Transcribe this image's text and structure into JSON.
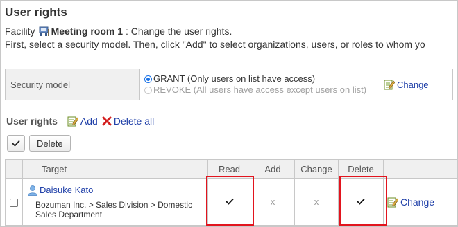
{
  "page": {
    "title": "User rights",
    "facility_prefix": "Facility",
    "facility_name": "Meeting room 1",
    "facility_suffix": ": Change the user rights.",
    "instruction": "First, select a security model. Then, click \"Add\" to select organizations, users, or roles to whom yo"
  },
  "security_model": {
    "label": "Security model",
    "grant_option": "GRANT (Only users on list have access)",
    "revoke_option": "REVOKE (All users have access except users on list)",
    "selected": "GRANT",
    "change_link": "Change"
  },
  "user_rights": {
    "title": "User rights",
    "add_link": "Add",
    "delete_all_link": "Delete all",
    "delete_button": "Delete",
    "columns": {
      "target": "Target",
      "read": "Read",
      "add": "Add",
      "change": "Change",
      "delete": "Delete"
    },
    "rows": [
      {
        "user_name": "Daisuke Kato",
        "organization": "Bozuman Inc. > Sales Division > Domestic Sales Department",
        "read": "granted",
        "add": "x",
        "change": "x",
        "delete": "granted",
        "change_link": "Change"
      }
    ]
  },
  "colors": {
    "link": "#1f3fa8",
    "highlight": "#e2141e",
    "header_bg": "#f0f0f0",
    "radio_selected": "#1a73e8"
  },
  "icons": [
    "facility-icon",
    "edit-icon",
    "delete-x-icon",
    "user-icon",
    "check-icon"
  ]
}
